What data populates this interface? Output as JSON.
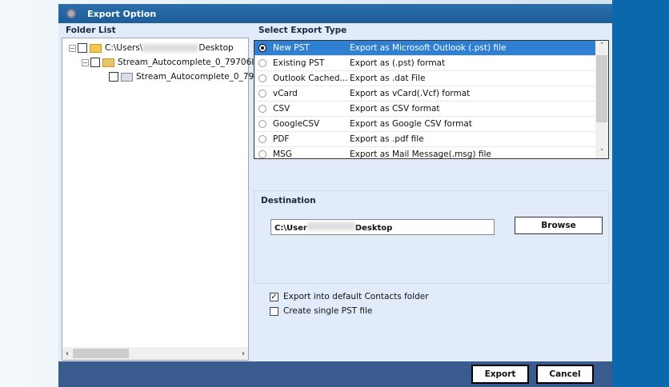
{
  "window": {
    "title": "Export Option"
  },
  "folder_list": {
    "label": "Folder List",
    "nodes": [
      {
        "prefix": "C:\\Users\\",
        "suffix": "Desktop"
      },
      {
        "label": "Stream_Autocomplete_0_79706I"
      },
      {
        "label": "Stream_Autocomplete_0_79"
      }
    ]
  },
  "export_type": {
    "label": "Select Export Type",
    "options": [
      {
        "name": "New PST",
        "desc": "Export as Microsoft Outlook (.pst) file",
        "selected": true
      },
      {
        "name": "Existing PST",
        "desc": "Export as (.pst) format"
      },
      {
        "name": "Outlook Cached...",
        "desc": "Export as .dat File"
      },
      {
        "name": "vCard",
        "desc": "Export as vCard(.Vcf) format"
      },
      {
        "name": "CSV",
        "desc": "Export as CSV format"
      },
      {
        "name": "GoogleCSV",
        "desc": "Export as Google CSV format"
      },
      {
        "name": "PDF",
        "desc": "Export as .pdf file"
      },
      {
        "name": "MSG",
        "desc": "Export as Mail Message(.msg) file"
      }
    ]
  },
  "destination": {
    "label": "Destination",
    "prefix": "C:\\User",
    "suffix": "Desktop",
    "browse": "Browse"
  },
  "options": {
    "default_contacts": {
      "label": "Export into default Contacts folder",
      "checked": true
    },
    "single_pst": {
      "label": "Create single PST file",
      "checked": false
    }
  },
  "footer": {
    "export": "Export",
    "cancel": "Cancel"
  }
}
